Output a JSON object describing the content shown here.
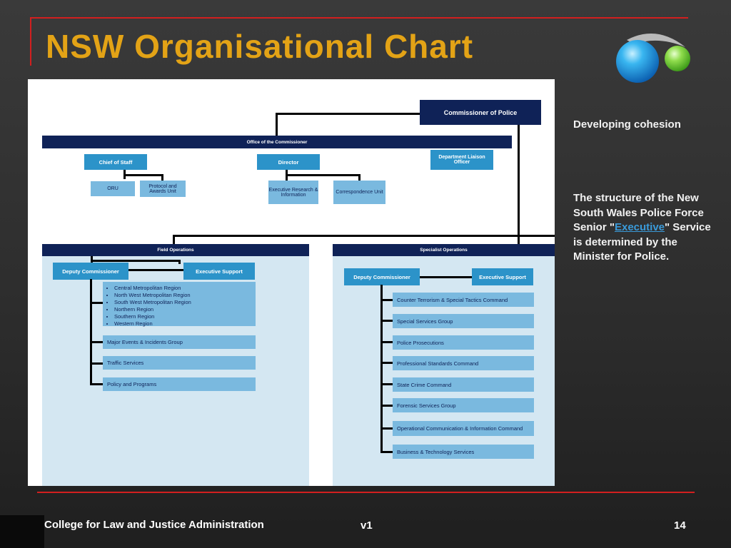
{
  "slide": {
    "title": "NSW Organisational Chart",
    "footer_left": "College for Law and Justice Administration",
    "footer_center": "v1",
    "page_number": "14"
  },
  "sidebar": {
    "heading": "Developing cohesion",
    "text_before": "The structure of the New South Wales Police Force Senior \"",
    "link": "Executive",
    "text_after": "\" Service is determined by the Minister for Police."
  },
  "chart": {
    "commissioner": "Commissioner of Police",
    "office_of_commissioner": "Office of the Commissioner",
    "chief_of_staff": "Chief of Staff",
    "director": "Director",
    "dept_liaison": "Department Liaison Officer",
    "oru": "ORU",
    "protocol": "Protocol and Awards Unit",
    "exec_research": "Executive Research & Information",
    "correspondence": "Correspondence Unit",
    "field_ops": {
      "header": "Field Operations",
      "deputy": "Deputy Commissioner",
      "exec_support": "Executive Support",
      "regions": [
        "Central Metropolitan Region",
        "North West Metropolitan Region",
        "South West Metropolitan Region",
        "Northern Region",
        "Southern Region",
        "Western Region"
      ],
      "units": [
        "Major Events & Incidents Group",
        "Traffic Services",
        "Policy and Programs"
      ]
    },
    "specialist_ops": {
      "header": "Specialist Operations",
      "deputy": "Deputy Commissioner",
      "exec_support": "Executive Support",
      "units": [
        "Counter Terrorism & Special Tactics Command",
        "Special Services Group",
        "Police Prosecutions",
        "Professional Standards Command",
        "State Crime Command",
        "Forensic Services Group",
        "Operational Communication & Information Command",
        "Business & Technology Services"
      ]
    }
  },
  "colors": {
    "title": "#e3a316",
    "accent_line": "#d21f1f",
    "navy": "#0f2257",
    "mid_blue": "#2c93c9",
    "light_blue": "#7ab9df",
    "panel": "#d4e7f2",
    "link": "#3a9ad9"
  }
}
